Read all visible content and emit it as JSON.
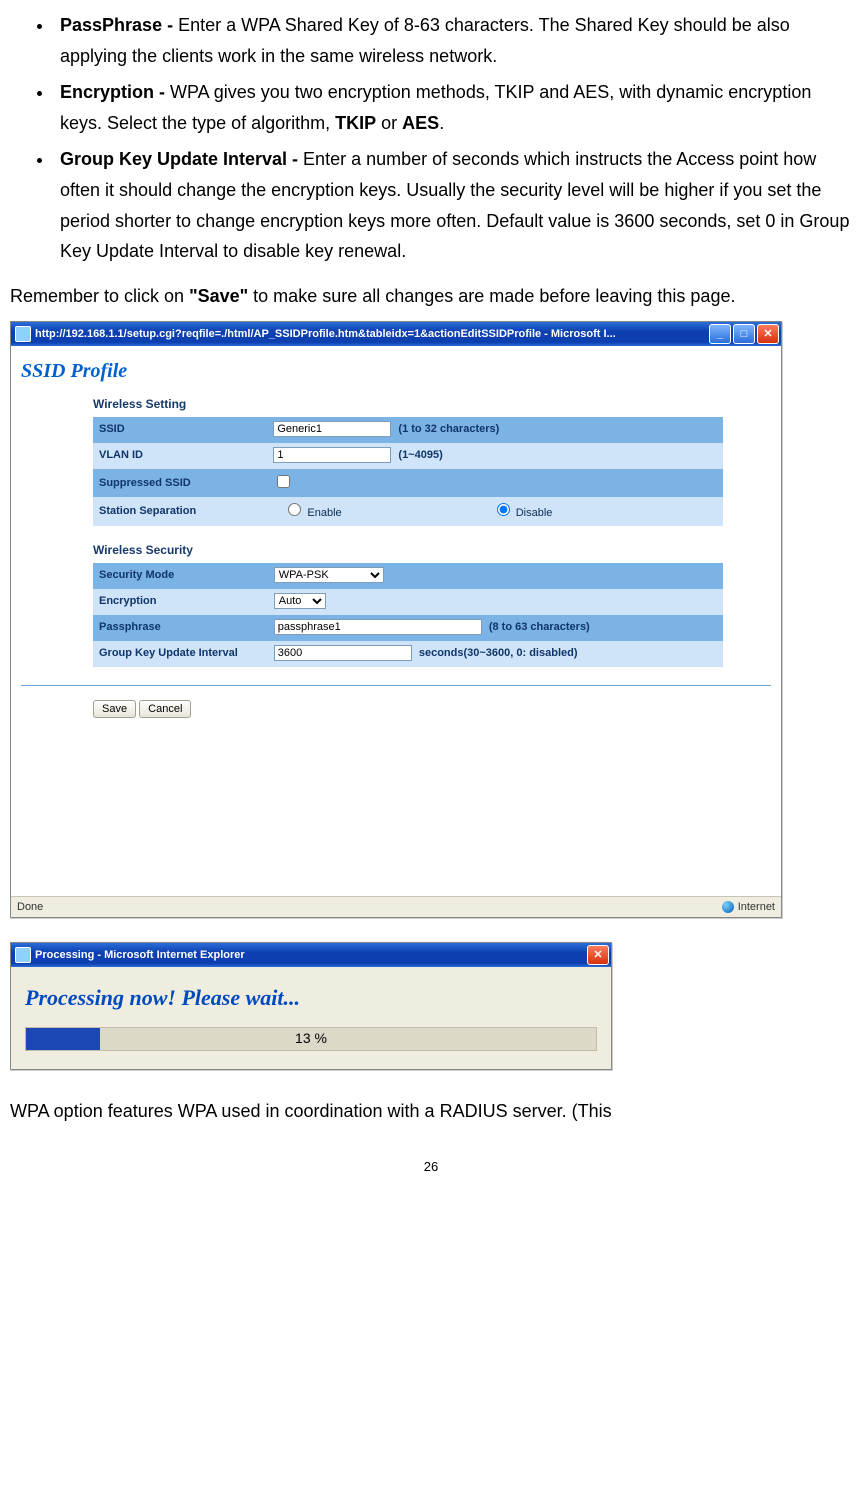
{
  "bullets": [
    {
      "term": "PassPhrase - ",
      "desc": "Enter a WPA Shared Key of 8-63 characters. The Shared Key should be also applying the clients work in the same wireless network."
    },
    {
      "term": "Encryption - ",
      "desc_pre": "WPA gives you two encryption methods, TKIP and AES, with dynamic encryption keys. Select the type of algorithm, ",
      "b1": "TKIP",
      "mid": " or ",
      "b2": "AES",
      "post": "."
    },
    {
      "term": "Group Key Update Interval - ",
      "desc": "Enter a number of seconds which instructs the Access point how often it should change the encryption keys. Usually the security level will be higher if you set the period shorter to change encryption keys more often. Default value is 3600 seconds, set 0 in Group Key Update Interval to disable key renewal."
    }
  ],
  "remember": {
    "pre": "Remember to click on ",
    "save": "\"Save\"",
    "post": " to make sure all changes are made before leaving this page."
  },
  "ie": {
    "title": "http://192.168.1.1/setup.cgi?reqfile=./html/AP_SSIDProfile.htm&tableidx=1&actionEditSSIDProfile - Microsoft I...",
    "heading": "SSID Profile",
    "wireless_setting": "Wireless Setting",
    "ssid_label": "SSID",
    "ssid_value": "Generic1",
    "ssid_hint": "(1 to 32 characters)",
    "vlan_label": "VLAN ID",
    "vlan_value": "1",
    "vlan_hint": "(1~4095)",
    "supp_label": "Suppressed SSID",
    "sep_label": "Station Separation",
    "sep_enable": "Enable",
    "sep_disable": "Disable",
    "wireless_security": "Wireless Security",
    "mode_label": "Security Mode",
    "mode_value": "WPA-PSK",
    "enc_label": "Encryption",
    "enc_value": "Auto",
    "pass_label": "Passphrase",
    "pass_value": "passphrase1",
    "pass_hint": "(8 to 63 characters)",
    "grp_label": "Group Key Update Interval",
    "grp_value": "3600",
    "grp_hint": "seconds(30~3600, 0: disabled)",
    "save_btn": "Save",
    "cancel_btn": "Cancel",
    "status_done": "Done",
    "status_zone": "Internet"
  },
  "proc": {
    "title": "Processing - Microsoft Internet Explorer",
    "heading": "Processing now! Please wait...",
    "percent_label": "13 %",
    "percent_value": 13
  },
  "tail": "WPA option features WPA used in coordination with a RADIUS server. (This",
  "pagenum": "26"
}
